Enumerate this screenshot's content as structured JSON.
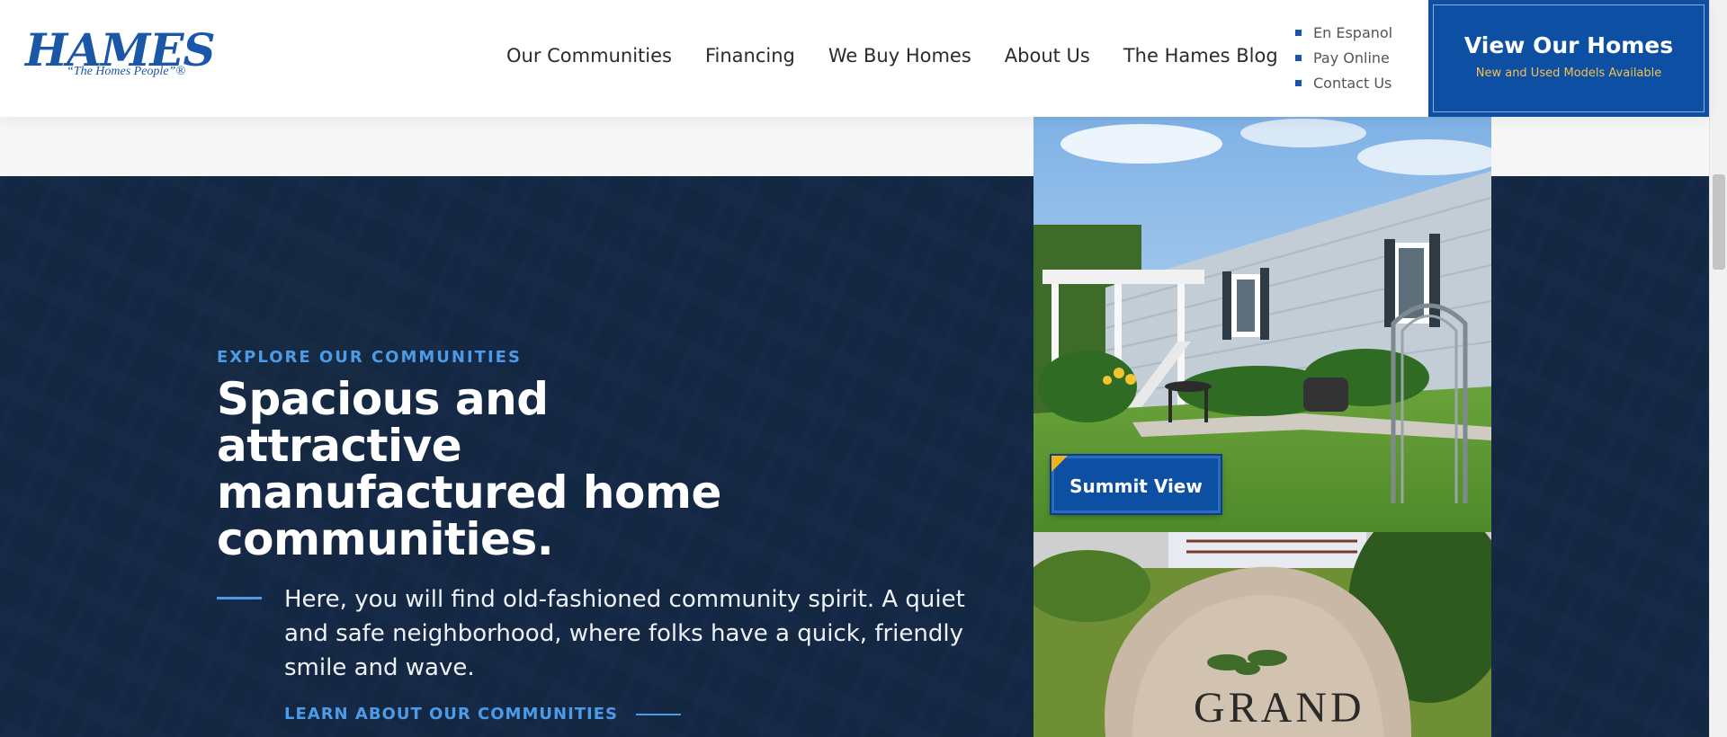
{
  "header": {
    "logo": {
      "wordmark": "HAMES",
      "tagline": "“The Homes People”®"
    },
    "main_nav": [
      {
        "label": "Our Communities"
      },
      {
        "label": "Financing"
      },
      {
        "label": "We Buy Homes"
      },
      {
        "label": "About Us"
      },
      {
        "label": "The Hames Blog"
      }
    ],
    "utility_nav": [
      {
        "label": "En Espanol"
      },
      {
        "label": "Pay Online"
      },
      {
        "label": "Contact Us"
      }
    ],
    "cta": {
      "title": "View Our Homes",
      "subtitle": "New and Used Models Available"
    }
  },
  "hero": {
    "eyebrow": "EXPLORE OUR COMMUNITIES",
    "headline": "Spacious and attractive manufactured home communities.",
    "body": "Here, you will find old-fashioned community spirit. A quiet and safe neighborhood, where folks have a quick, friendly smile and wave.",
    "link_label": "LEARN ABOUT OUR COMMUNITIES"
  },
  "photos": {
    "featured_badge": "Summit View",
    "sign_text": "GRAND"
  },
  "colors": {
    "brand_blue": "#0d4fa3",
    "accent_blue": "#4c9be8",
    "accent_gold": "#f2c14e",
    "hero_overlay": "#12264a"
  }
}
